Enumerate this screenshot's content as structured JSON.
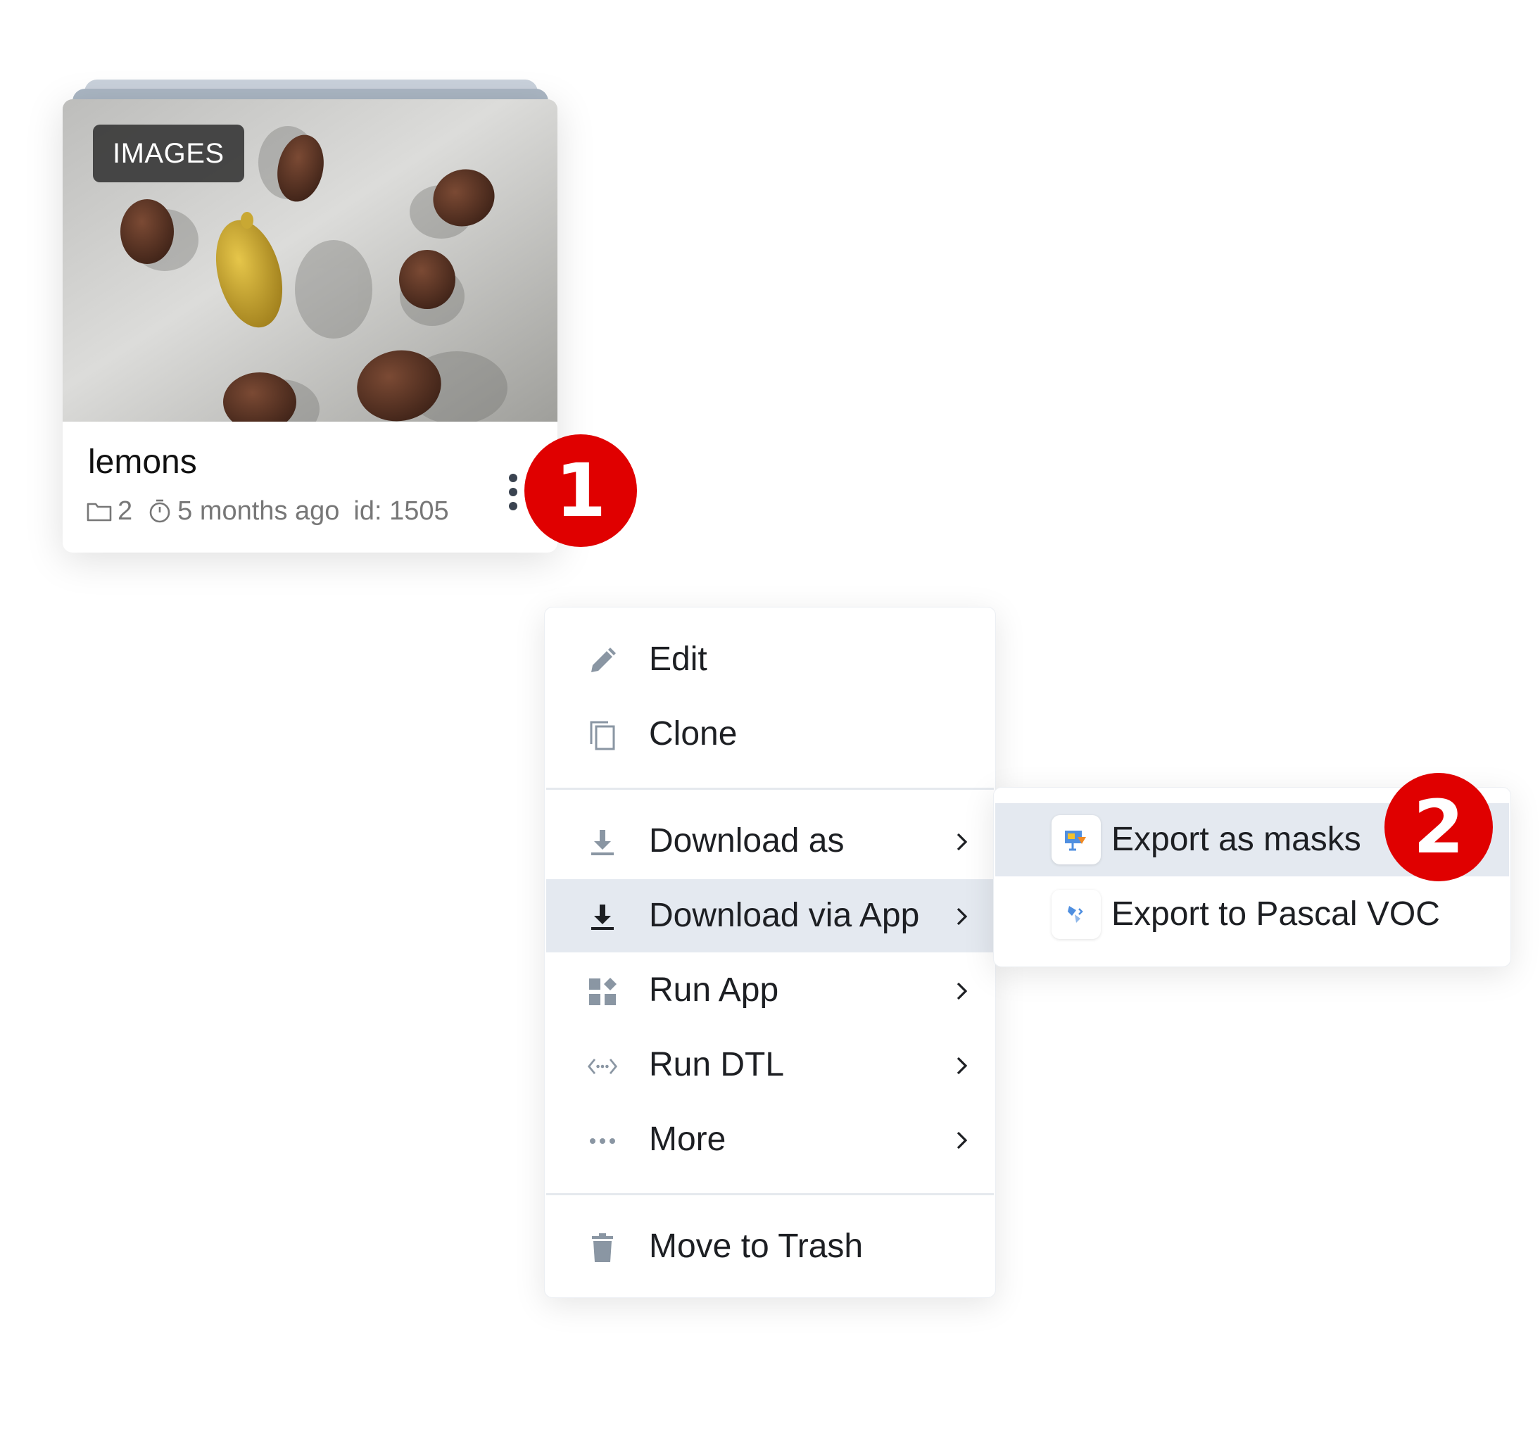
{
  "card": {
    "badge": "IMAGES",
    "title": "lemons",
    "datasets_count": "2",
    "updated": "5 months ago",
    "id_text": "id: 1505"
  },
  "steps": {
    "first": "1",
    "second": "2"
  },
  "menu": {
    "items": [
      {
        "label": "Edit",
        "icon": "pencil-icon"
      },
      {
        "label": "Clone",
        "icon": "copy-icon"
      },
      {
        "label": "Download as",
        "icon": "download-icon"
      },
      {
        "label": "Download via App",
        "icon": "download-icon"
      },
      {
        "label": "Run App",
        "icon": "apps-icon"
      },
      {
        "label": "Run DTL",
        "icon": "code-arrows-icon"
      },
      {
        "label": "More",
        "icon": "ellipsis-icon"
      },
      {
        "label": "Move to Trash",
        "icon": "trash-icon"
      }
    ]
  },
  "submenu": {
    "items": [
      {
        "label": "Export as masks",
        "icon": "masks-app-icon"
      },
      {
        "label": "Export to Pascal VOC",
        "icon": "pascal-voc-app-icon"
      }
    ]
  },
  "colors": {
    "marker_red": "#e00000",
    "active_row": "#e4e9f0",
    "icon_gray": "#8a96a3",
    "text_dark": "#1d1f23"
  }
}
